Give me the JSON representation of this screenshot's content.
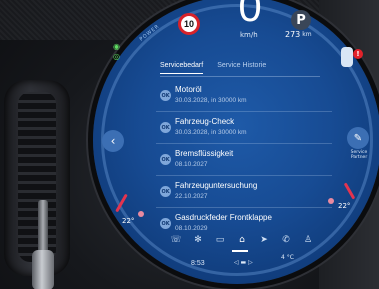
{
  "status": {
    "speed_limit": "10",
    "speed": "0",
    "speed_unit": "km/h",
    "gear": "P",
    "range_value": "273",
    "range_unit": "km",
    "power_label": "POWER"
  },
  "tabs": [
    {
      "label": "Servicebedarf",
      "active": true
    },
    {
      "label": "Service Historie",
      "active": false
    }
  ],
  "service_items": [
    {
      "badge": "OK",
      "title": "Motoröl",
      "subtitle": "30.03.2028, in 30000 km"
    },
    {
      "badge": "OK",
      "title": "Fahrzeug-Check",
      "subtitle": "30.03.2028, in 30000 km"
    },
    {
      "badge": "OK",
      "title": "Bremsflüssigkeit",
      "subtitle": "08.10.2027"
    },
    {
      "badge": "OK",
      "title": "Fahrzeuguntersuchung",
      "subtitle": "22.10.2027"
    },
    {
      "badge": "OK",
      "title": "Gasdruckfeder Frontklappe",
      "subtitle": "08.10.2029"
    }
  ],
  "side": {
    "service_partner_label": "Service Partner",
    "temp_left": "22°",
    "temp_right": "22°"
  },
  "bottom": {
    "clock": "8:53",
    "outside_temp": "4 °C"
  },
  "colors": {
    "accent": "#1e5aa8",
    "alert_red": "#e2222a",
    "ok_badge": "#7fa7da"
  },
  "icons": [
    "back-arrow-icon",
    "service-wrench-icon",
    "home-icon",
    "navigation-icon",
    "phone-icon",
    "fan-icon",
    "seat-heat-icon",
    "user-icon",
    "car-icon"
  ]
}
